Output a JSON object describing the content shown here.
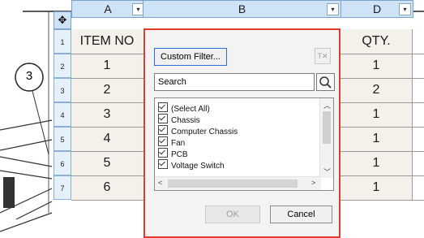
{
  "table": {
    "columns": [
      "A",
      "B",
      "D"
    ],
    "row_numbers": [
      "1",
      "2",
      "3",
      "4",
      "5",
      "6",
      "7"
    ],
    "col_a": [
      "ITEM NO",
      "1",
      "2",
      "3",
      "4",
      "5",
      "6"
    ],
    "col_d": [
      "QTY.",
      "1",
      "2",
      "1",
      "1",
      "1",
      "1"
    ],
    "balloon_label": "3"
  },
  "dialog": {
    "custom_filter_label": "Custom Filter...",
    "search_placeholder": "Search",
    "items": [
      "(Select All)",
      "Chassis",
      "Computer Chassis",
      "Fan",
      "PCB",
      "Voltage Switch"
    ],
    "ok_label": "OK",
    "cancel_label": "Cancel"
  },
  "colors": {
    "dialog_border": "#e23b2e",
    "header_fill": "#cfe3f7",
    "custom_filter_border": "#2a6ed8"
  }
}
